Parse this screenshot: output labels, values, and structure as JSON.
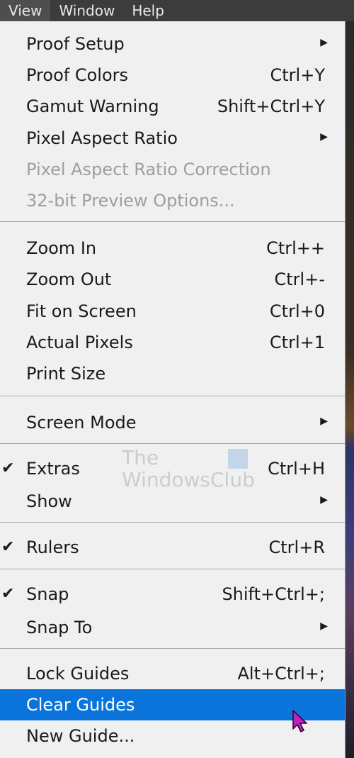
{
  "menubar": {
    "items": [
      {
        "label": "View"
      },
      {
        "label": "Window"
      },
      {
        "label": "Help"
      }
    ]
  },
  "menu": {
    "items": [
      {
        "label": "Proof Setup",
        "shortcut": "",
        "submenu": true,
        "checked": false,
        "enabled": true
      },
      {
        "label": "Proof Colors",
        "shortcut": "Ctrl+Y",
        "submenu": false,
        "checked": false,
        "enabled": true
      },
      {
        "label": "Gamut Warning",
        "shortcut": "Shift+Ctrl+Y",
        "submenu": false,
        "checked": false,
        "enabled": true
      },
      {
        "label": "Pixel Aspect Ratio",
        "shortcut": "",
        "submenu": true,
        "checked": false,
        "enabled": true
      },
      {
        "label": "Pixel Aspect Ratio Correction",
        "shortcut": "",
        "submenu": false,
        "checked": false,
        "enabled": false
      },
      {
        "label": "32-bit Preview Options...",
        "shortcut": "",
        "submenu": false,
        "checked": false,
        "enabled": false
      },
      {
        "label": "Zoom In",
        "shortcut": "Ctrl++",
        "submenu": false,
        "checked": false,
        "enabled": true
      },
      {
        "label": "Zoom Out",
        "shortcut": "Ctrl+-",
        "submenu": false,
        "checked": false,
        "enabled": true
      },
      {
        "label": "Fit on Screen",
        "shortcut": "Ctrl+0",
        "submenu": false,
        "checked": false,
        "enabled": true
      },
      {
        "label": "Actual Pixels",
        "shortcut": "Ctrl+1",
        "submenu": false,
        "checked": false,
        "enabled": true
      },
      {
        "label": "Print Size",
        "shortcut": "",
        "submenu": false,
        "checked": false,
        "enabled": true
      },
      {
        "label": "Screen Mode",
        "shortcut": "",
        "submenu": true,
        "checked": false,
        "enabled": true
      },
      {
        "label": "Extras",
        "shortcut": "Ctrl+H",
        "submenu": false,
        "checked": true,
        "enabled": true
      },
      {
        "label": "Show",
        "shortcut": "",
        "submenu": true,
        "checked": false,
        "enabled": true
      },
      {
        "label": "Rulers",
        "shortcut": "Ctrl+R",
        "submenu": false,
        "checked": true,
        "enabled": true
      },
      {
        "label": "Snap",
        "shortcut": "Shift+Ctrl+;",
        "submenu": false,
        "checked": true,
        "enabled": true
      },
      {
        "label": "Snap To",
        "shortcut": "",
        "submenu": true,
        "checked": false,
        "enabled": true
      },
      {
        "label": "Lock Guides",
        "shortcut": "Alt+Ctrl+;",
        "submenu": false,
        "checked": false,
        "enabled": true
      },
      {
        "label": "Clear Guides",
        "shortcut": "",
        "submenu": false,
        "checked": false,
        "enabled": true,
        "highlighted": true
      },
      {
        "label": "New Guide...",
        "shortcut": "",
        "submenu": false,
        "checked": false,
        "enabled": true
      }
    ],
    "check_glyph": "✔",
    "arrow_glyph": "▶"
  },
  "watermark": {
    "line1": "The",
    "line2": "WindowsClub"
  },
  "colors": {
    "menu_bg": "#f0f0f0",
    "highlight": "#0a74da",
    "disabled_text": "#9e9e9e",
    "menubar_bg": "#3c3c3c",
    "cursor": "#c020c0"
  }
}
